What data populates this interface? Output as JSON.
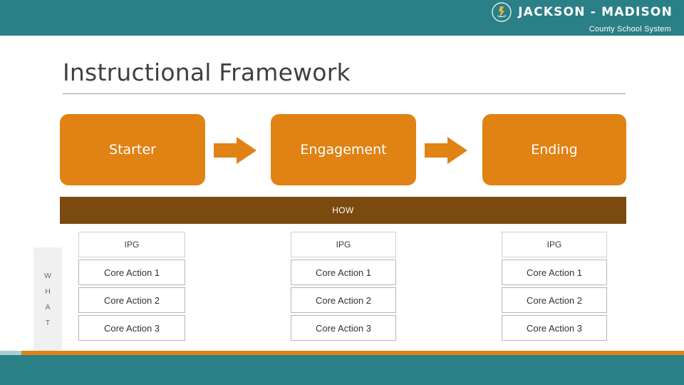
{
  "banner": {
    "logo_icon": "torch-runner-logo-icon",
    "org_name": "JACKSON - MADISON",
    "org_subtitle": "County School System",
    "banner_color": "#2b7f86"
  },
  "slide": {
    "title": "Instructional Framework"
  },
  "phases": [
    {
      "label": "Starter"
    },
    {
      "label": "Engagement"
    },
    {
      "label": "Ending"
    }
  ],
  "arrows": [
    {
      "name": "arrow-starter-to-engagement"
    },
    {
      "name": "arrow-engagement-to-ending"
    }
  ],
  "how_bar": {
    "label": "HOW",
    "color": "#7b4a11"
  },
  "what_bar": {
    "letters": [
      "W",
      "H",
      "A",
      "T"
    ]
  },
  "columns": [
    {
      "header": "IPG",
      "items": [
        "Core Action 1",
        "Core Action 2",
        "Core Action 3"
      ]
    },
    {
      "header": "IPG",
      "items": [
        "Core Action 1",
        "Core Action 2",
        "Core Action 3"
      ]
    },
    {
      "header": "IPG",
      "items": [
        "Core Action 1",
        "Core Action 2",
        "Core Action 3"
      ]
    }
  ],
  "theme": {
    "accent_orange": "#e08214",
    "teal": "#2b7f86",
    "brown": "#7b4a11"
  }
}
